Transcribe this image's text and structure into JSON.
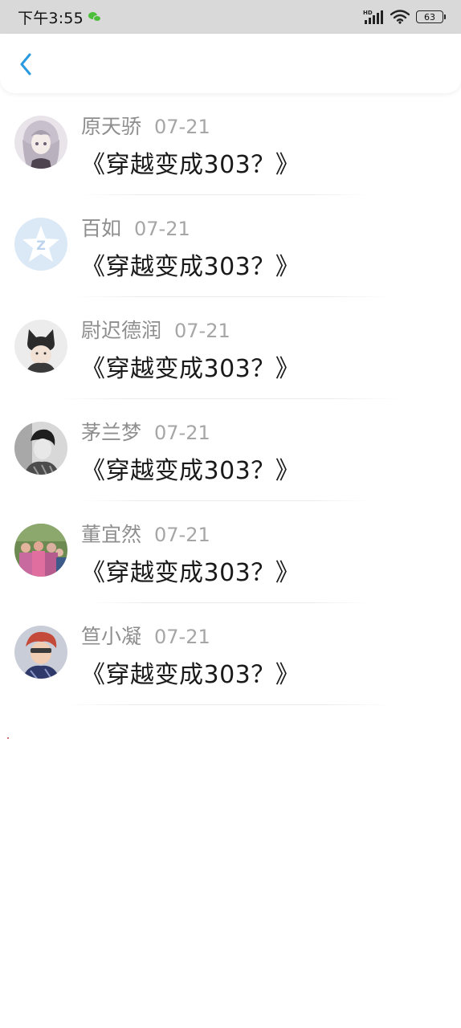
{
  "status_bar": {
    "time": "下午3:55",
    "battery": "63",
    "icons": [
      "wechat-icon",
      "hd-signal-icon",
      "wifi-icon",
      "battery-icon"
    ]
  },
  "nav": {
    "back_icon": "chevron-left-icon",
    "accent_color": "#2a9ae0"
  },
  "comments": [
    {
      "name": "原天骄",
      "date": "07-21",
      "title": "《穿越变成303？》",
      "avatar": "anime-girl-avatar"
    },
    {
      "name": "百如",
      "date": "07-21",
      "title": "《穿越变成303？》",
      "avatar": "qq-default-avatar"
    },
    {
      "name": "尉迟德润",
      "date": "07-21",
      "title": "《穿越变成303？》",
      "avatar": "cat-hat-avatar"
    },
    {
      "name": "茅兰梦",
      "date": "07-21",
      "title": "《穿越变成303？》",
      "avatar": "bw-portrait-avatar"
    },
    {
      "name": "董宜然",
      "date": "07-21",
      "title": "《穿越变成303？》",
      "avatar": "group-photo-avatar"
    },
    {
      "name": "笪小凝",
      "date": "07-21",
      "title": "《穿越变成303？》",
      "avatar": "anime-boy-avatar"
    }
  ]
}
